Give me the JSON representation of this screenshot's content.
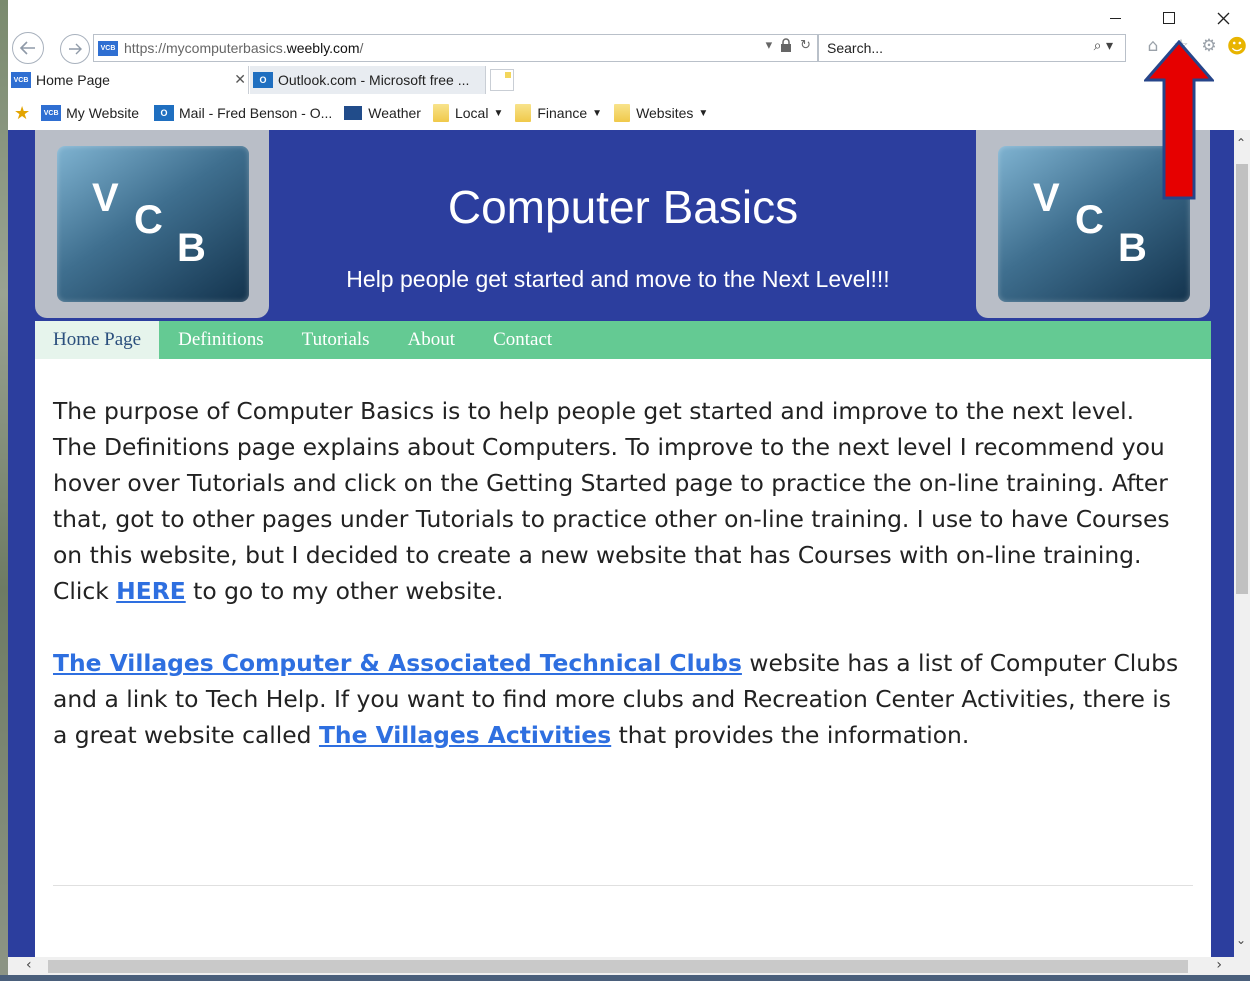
{
  "browser": {
    "url_prefix": "https://mycomputerbasics.",
    "url_domain": "weebly.com",
    "url_suffix": "/",
    "search_placeholder": "Search...",
    "tabs": [
      {
        "label": "Home Page",
        "favicon": "vcb-favicon",
        "active": true
      },
      {
        "label": "Outlook.com - Microsoft free ...",
        "favicon": "outlook-favicon",
        "active": false
      }
    ],
    "favorites": [
      {
        "label": "My Website",
        "icon": "vcb-favicon"
      },
      {
        "label": "Mail - Fred Benson - O...",
        "icon": "outlook-favicon"
      },
      {
        "label": "Weather",
        "icon": "weather-favicon"
      },
      {
        "label": "Local",
        "icon": "folder-icon",
        "dropdown": true
      },
      {
        "label": "Finance",
        "icon": "folder-icon",
        "dropdown": true
      },
      {
        "label": "Websites",
        "icon": "folder-icon",
        "dropdown": true
      }
    ]
  },
  "site": {
    "logo_letters": [
      "V",
      "C",
      "B"
    ],
    "title": "Computer Basics",
    "tagline": "Help people get started and move to the Next Level!!!",
    "nav": [
      "Home Page",
      "Definitions",
      "Tutorials",
      "About",
      "Contact"
    ],
    "content": {
      "p1_text1": "The purpose of Computer Basics is to help people get started and improve to the next level.  The Definitions page explains about Computers.  To improve to the next level I recommend you hover over Tutorials and click on the Getting Started page to practice the on-line training.  After that, got to other pages under Tutorials to practice other on-line training.  I use to have Courses on this website, but I decided to create a new website that has Courses with on-line training.  Click ",
      "p1_link": "HERE",
      "p1_text2": " to go to my other website.",
      "p2_link1": "The Villages Computer & Associated Technical Clubs",
      "p2_text1": " website has a list of Computer Clubs and a link to Tech Help.  If you want to find more clubs and Recreation Center Activities, there is a great website called ",
      "p2_link2": "The Villages Activities",
      "p2_text2": " that provides the information."
    }
  },
  "colors": {
    "header_bg": "#2c3e9e",
    "menu_bg": "#64ca93",
    "link": "#2e6fe0",
    "annotation_arrow": "#e60000"
  }
}
